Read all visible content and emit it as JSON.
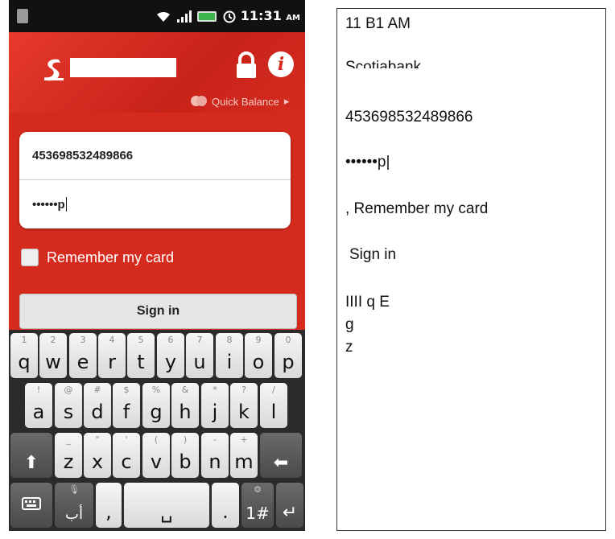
{
  "status_bar": {
    "time": "11:31",
    "ampm": "AM",
    "icons": [
      "wifi-icon",
      "signal-icon",
      "battery-icon",
      "alarm-icon"
    ]
  },
  "app": {
    "brand": "Scotiabank",
    "brand_color": "#d52b1e",
    "quick_balance": "Quick Balance",
    "card_number": "453698532489866",
    "password_masked": "••••••p",
    "remember_label": "Remember my card",
    "sign_in_label": "Sign in"
  },
  "keyboard": {
    "row1": [
      {
        "main": "q",
        "hint": "1"
      },
      {
        "main": "w",
        "hint": "2"
      },
      {
        "main": "e",
        "hint": "3"
      },
      {
        "main": "r",
        "hint": "4"
      },
      {
        "main": "t",
        "hint": "5"
      },
      {
        "main": "y",
        "hint": "6"
      },
      {
        "main": "u",
        "hint": "7"
      },
      {
        "main": "i",
        "hint": "8"
      },
      {
        "main": "o",
        "hint": "9"
      },
      {
        "main": "p",
        "hint": "0"
      }
    ],
    "row2": [
      {
        "main": "a",
        "hint": "!"
      },
      {
        "main": "s",
        "hint": "@"
      },
      {
        "main": "d",
        "hint": "#"
      },
      {
        "main": "f",
        "hint": "$"
      },
      {
        "main": "g",
        "hint": "%"
      },
      {
        "main": "h",
        "hint": "&"
      },
      {
        "main": "j",
        "hint": "*"
      },
      {
        "main": "k",
        "hint": "?"
      },
      {
        "main": "l",
        "hint": "/"
      }
    ],
    "row3": [
      {
        "main": "z",
        "hint": "_"
      },
      {
        "main": "x",
        "hint": "\""
      },
      {
        "main": "c",
        "hint": "'"
      },
      {
        "main": "v",
        "hint": "("
      },
      {
        "main": "b",
        "hint": ")"
      },
      {
        "main": "n",
        "hint": "-"
      },
      {
        "main": "m",
        "hint": "+"
      }
    ],
    "shift": "⬆",
    "backspace": "⬅",
    "lang": "أب",
    "comma": ",",
    "period": ".",
    "symbols": "1#",
    "enter": "↵"
  },
  "transcript": {
    "line_time": "11 B1 AM",
    "line_brand": "Scotiabank",
    "line_card": "453698532489866",
    "line_password": "••••••p|",
    "line_remember": ", Remember my card",
    "line_signin": "Sign in",
    "line_keys1": "IIII q E",
    "line_keys2": "g",
    "line_keys3": "z"
  }
}
